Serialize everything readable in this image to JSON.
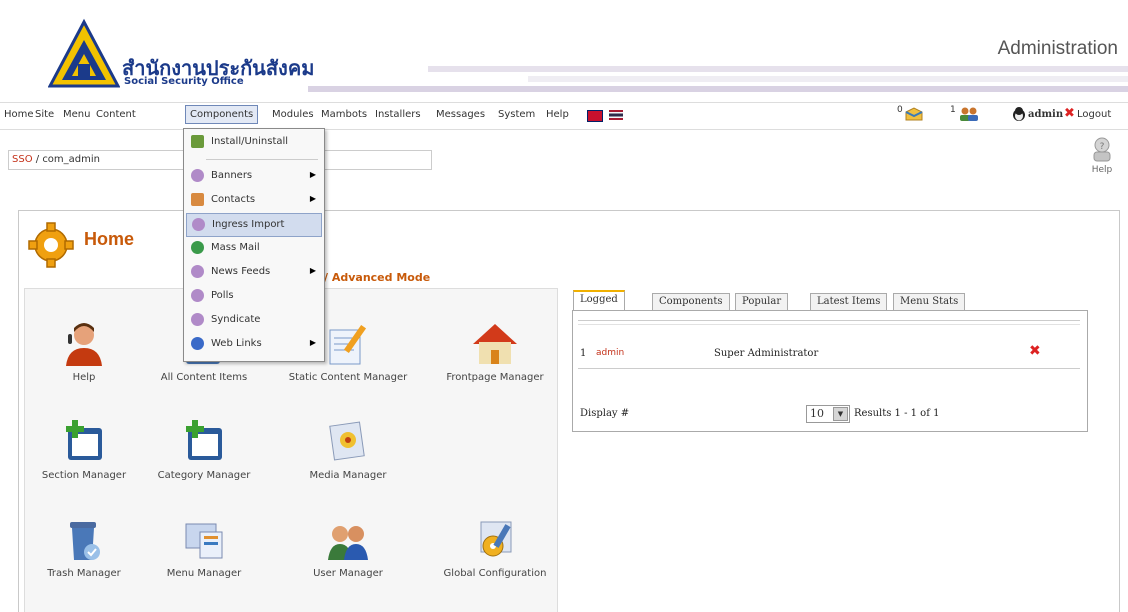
{
  "header": {
    "org_name_thai": "สำนักงานประกันสังคม",
    "org_name_en": "Social Security Office",
    "admin_title": "Administration"
  },
  "menubar": {
    "items": [
      "Home",
      "Site",
      "Menu",
      "Content",
      "Components",
      "Modules",
      "Mambots",
      "Installers",
      "Messages",
      "System",
      "Help"
    ],
    "messages_count": "0",
    "users_online": "1",
    "user": "admin",
    "logout": "Logout"
  },
  "pathway": {
    "site": "SSO",
    "path": "/ com_admin"
  },
  "help_button": "Help",
  "dropdown": {
    "items": [
      {
        "label": "Install/Uninstall",
        "submenu": false
      },
      {
        "label": "Banners",
        "submenu": true
      },
      {
        "label": "Contacts",
        "submenu": true
      },
      {
        "label": "Ingress Import",
        "submenu": false
      },
      {
        "label": "Mass Mail",
        "submenu": false
      },
      {
        "label": "News Feeds",
        "submenu": true
      },
      {
        "label": "Polls",
        "submenu": false
      },
      {
        "label": "Syndicate",
        "submenu": false
      },
      {
        "label": "Web Links",
        "submenu": true
      }
    ]
  },
  "main": {
    "title": "Home",
    "mode_link": "/ Advanced Mode",
    "control_panel": [
      {
        "label": "Help",
        "icon": "help-person-icon"
      },
      {
        "label": "All Content Items",
        "icon": "all-content-icon"
      },
      {
        "label": "Static Content Manager",
        "icon": "static-content-icon"
      },
      {
        "label": "Frontpage Manager",
        "icon": "frontpage-icon"
      },
      {
        "label": "Section Manager",
        "icon": "section-icon"
      },
      {
        "label": "Category Manager",
        "icon": "category-icon"
      },
      {
        "label": "Media Manager",
        "icon": "media-icon"
      },
      {
        "label": "Trash Manager",
        "icon": "trash-icon"
      },
      {
        "label": "Menu Manager",
        "icon": "menu-manager-icon"
      },
      {
        "label": "User Manager",
        "icon": "user-manager-icon"
      },
      {
        "label": "Global Configuration",
        "icon": "global-config-icon"
      }
    ]
  },
  "tabs": {
    "labels": [
      "Logged",
      "Components",
      "Popular",
      "Latest Items",
      "Menu Stats"
    ],
    "active": "Logged",
    "logged_row": {
      "num": "1",
      "user": "admin",
      "role": "Super Administrator"
    },
    "display_label": "Display #",
    "display_value": "10",
    "results": "Results 1 - 1 of 1"
  },
  "colors": {
    "accent_orange": "#c85a0a",
    "menu_highlight": "#d2dcee",
    "link_red": "#c4321a"
  }
}
